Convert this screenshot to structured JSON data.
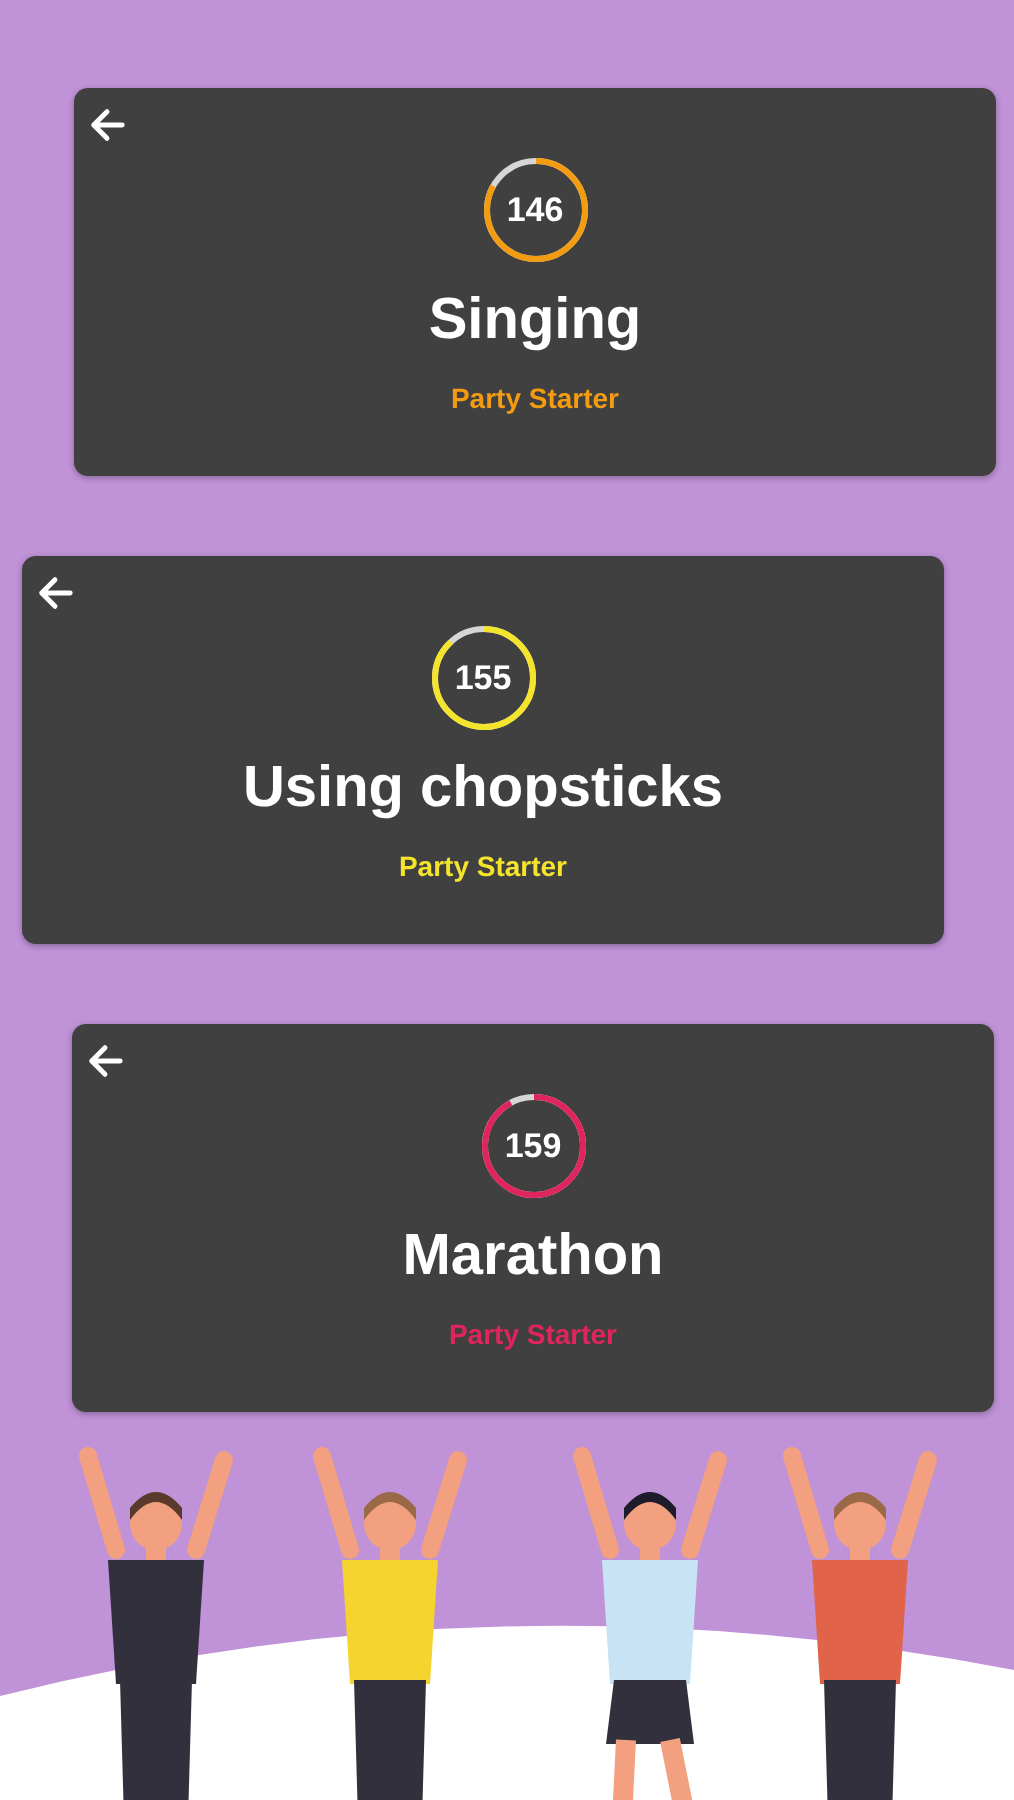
{
  "cards": [
    {
      "score": "146",
      "level": 0.83,
      "color": "#f39c12",
      "title": "Singing",
      "subtitle": "Party Starter"
    },
    {
      "score": "155",
      "level": 0.88,
      "color": "#f4e42c",
      "title": "Using chopsticks",
      "subtitle": "Party Starter"
    },
    {
      "score": "159",
      "level": 0.92,
      "color": "#e0245e",
      "title": "Marathon",
      "subtitle": "Party Starter"
    }
  ]
}
